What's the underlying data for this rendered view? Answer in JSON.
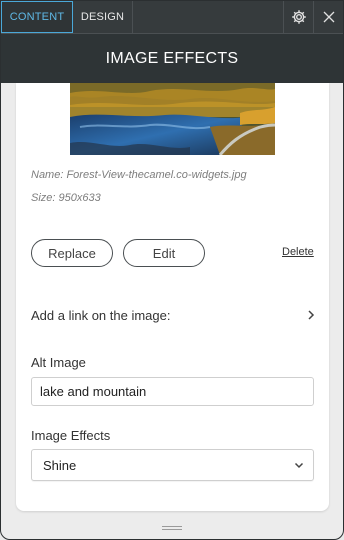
{
  "tabs": {
    "content_label": "CONTENT",
    "design_label": "DESIGN"
  },
  "icons": {
    "settings": "gear-icon",
    "close": "close-icon",
    "link_arrow": "chevron-right-icon",
    "select_arrow": "chevron-down-icon",
    "resize": "resize-grip-icon"
  },
  "header": {
    "title": "IMAGE EFFECTS"
  },
  "image": {
    "name_text": "Name: Forest-View-thecamel.co-widgets.jpg",
    "size_text": "Size: 950x633"
  },
  "actions": {
    "replace_label": "Replace",
    "edit_label": "Edit",
    "delete_label": "Delete"
  },
  "link": {
    "label": "Add a link on the image:"
  },
  "alt": {
    "label": "Alt Image",
    "value": "lake and mountain"
  },
  "effects": {
    "label": "Image Effects",
    "selected": "Shine"
  },
  "colors": {
    "accent": "#5fb9e6",
    "header_bg": "#2e3436",
    "tabbar_bg": "#363b3d"
  }
}
